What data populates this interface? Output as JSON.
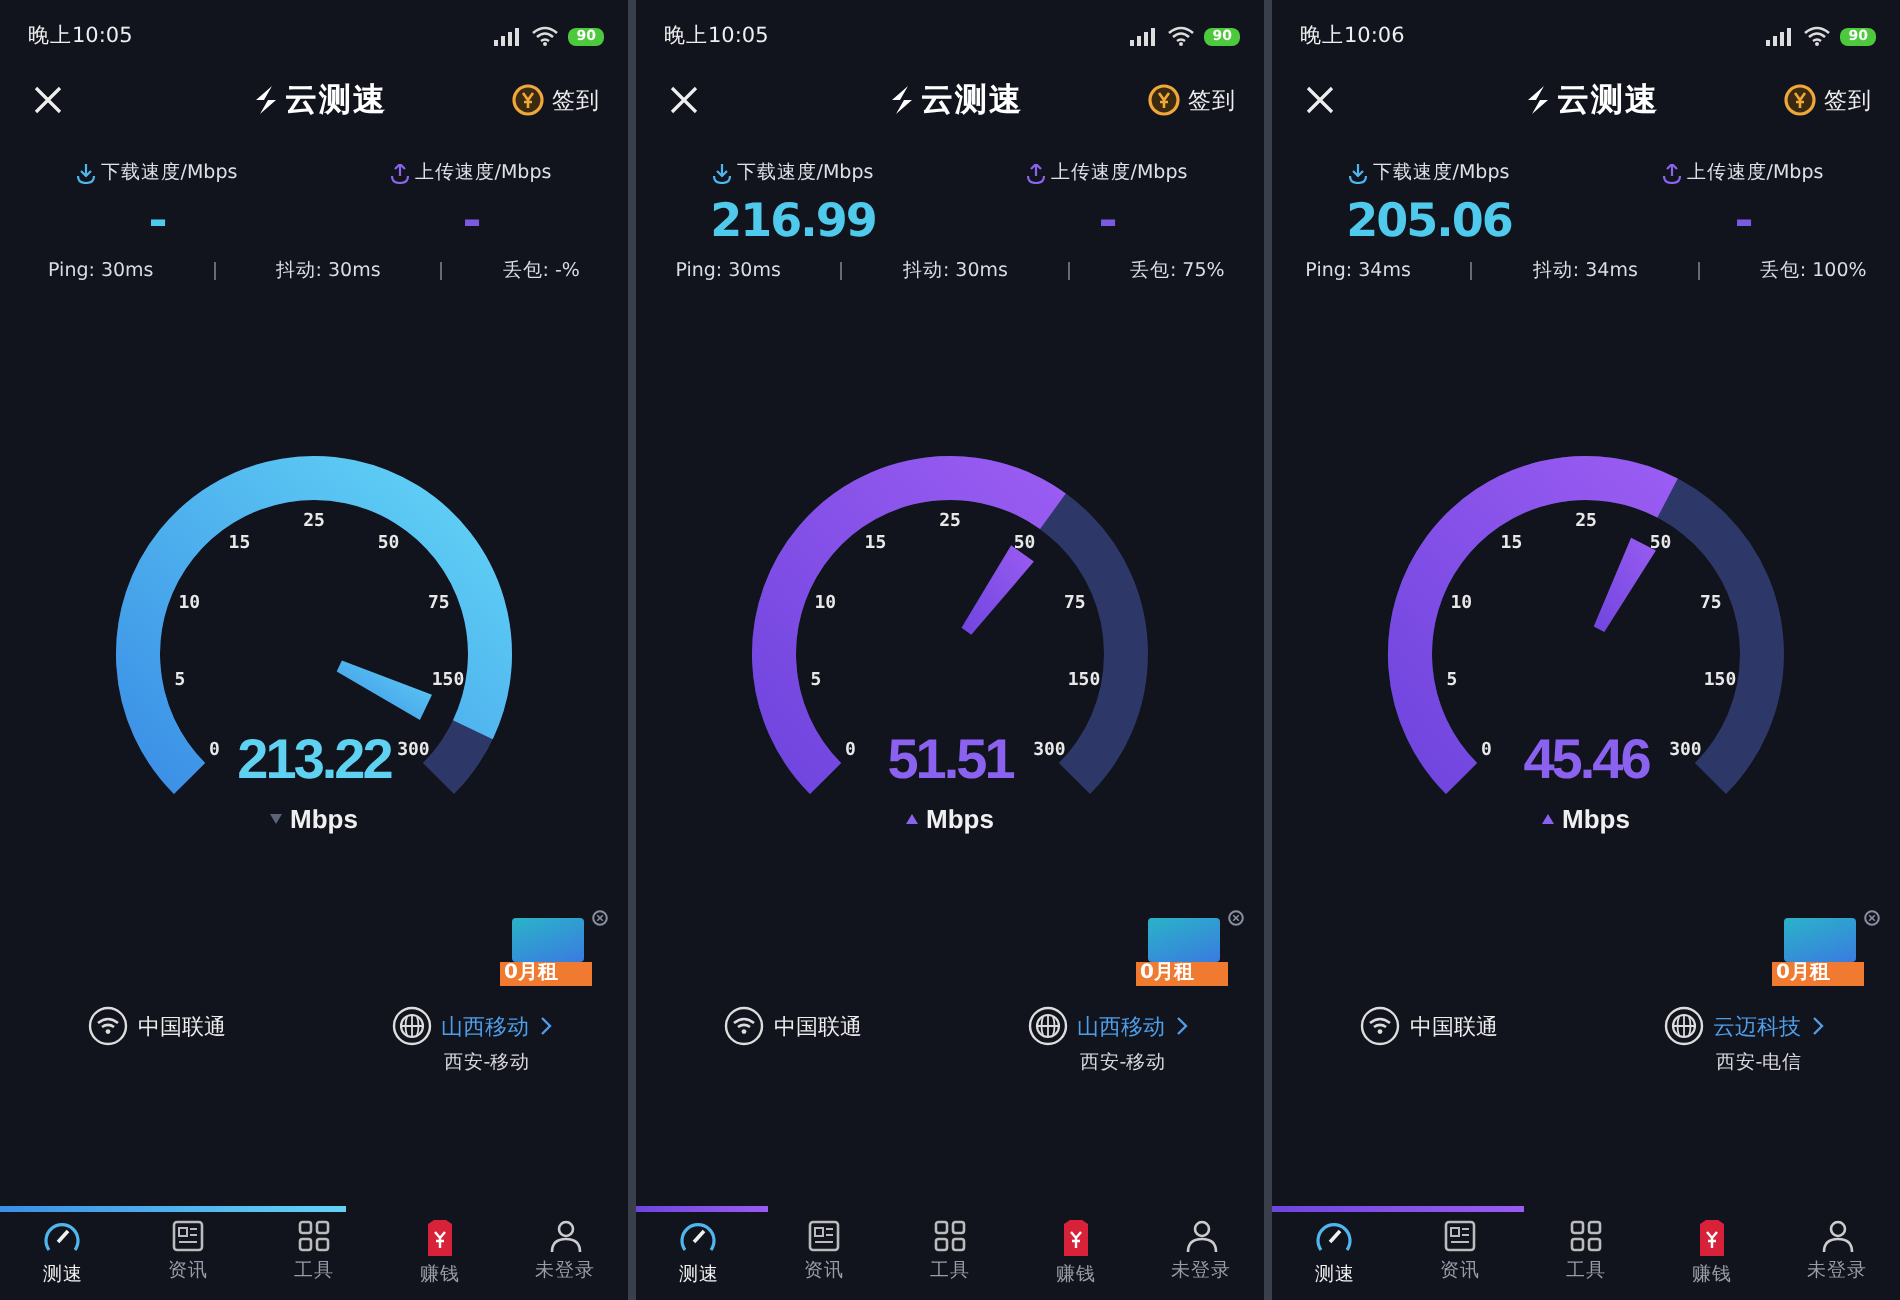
{
  "phones": [
    {
      "status_time": "晚上10:05",
      "battery": "90",
      "title": "云测速",
      "checkin": "签到",
      "download_label": "下载速度/Mbps",
      "upload_label": "上传速度/Mbps",
      "download_value": "-",
      "upload_value": "-",
      "ping": "Ping: 30ms",
      "jitter": "抖动: 30ms",
      "loss": "丢包: -%",
      "gauge": {
        "kind": "download",
        "ticks": [
          "0",
          "5",
          "10",
          "15",
          "25",
          "50",
          "75",
          "150",
          "300"
        ],
        "reading": "213.22",
        "unit": "Mbps"
      },
      "ad_label": "0月租",
      "network": "中国联通",
      "server": "山西移动",
      "server_location": "西安-移动",
      "progress": {
        "level": 0.55
      },
      "nav": [
        {
          "label": "测速",
          "selected": true
        },
        {
          "label": "资讯",
          "selected": false
        },
        {
          "label": "工具",
          "selected": false
        },
        {
          "label": "赚钱",
          "selected": false
        },
        {
          "label": "未登录",
          "selected": false
        }
      ]
    },
    {
      "status_time": "晚上10:05",
      "battery": "90",
      "title": "云测速",
      "checkin": "签到",
      "download_label": "下载速度/Mbps",
      "upload_label": "上传速度/Mbps",
      "download_value": "216.99",
      "upload_value": "-",
      "ping": "Ping: 30ms",
      "jitter": "抖动: 30ms",
      "loss": "丢包: 75%",
      "gauge": {
        "kind": "upload",
        "ticks": [
          "0",
          "5",
          "10",
          "15",
          "25",
          "50",
          "75",
          "150",
          "300"
        ],
        "reading": "51.51",
        "unit": "Mbps"
      },
      "ad_label": "0月租",
      "network": "中国联通",
      "server": "山西移动",
      "server_location": "西安-移动",
      "progress": {
        "level": 0.21
      },
      "nav": [
        {
          "label": "测速",
          "selected": true
        },
        {
          "label": "资讯",
          "selected": false
        },
        {
          "label": "工具",
          "selected": false
        },
        {
          "label": "赚钱",
          "selected": false
        },
        {
          "label": "未登录",
          "selected": false
        }
      ]
    },
    {
      "status_time": "晚上10:06",
      "battery": "90",
      "title": "云测速",
      "checkin": "签到",
      "download_label": "下载速度/Mbps",
      "upload_label": "上传速度/Mbps",
      "download_value": "205.06",
      "upload_value": "-",
      "ping": "Ping: 34ms",
      "jitter": "抖动: 34ms",
      "loss": "丢包: 100%",
      "gauge": {
        "kind": "upload",
        "ticks": [
          "0",
          "5",
          "10",
          "15",
          "25",
          "50",
          "75",
          "150",
          "300"
        ],
        "reading": "45.46",
        "unit": "Mbps"
      },
      "ad_label": "0月租",
      "network": "中国联通",
      "server": "云迈科技",
      "server_location": "西安-电信",
      "progress": {
        "level": 0.4
      },
      "nav": [
        {
          "label": "测速",
          "selected": true
        },
        {
          "label": "资讯",
          "selected": false
        },
        {
          "label": "工具",
          "selected": false
        },
        {
          "label": "赚钱",
          "selected": false
        },
        {
          "label": "未登录",
          "selected": false
        }
      ]
    }
  ]
}
